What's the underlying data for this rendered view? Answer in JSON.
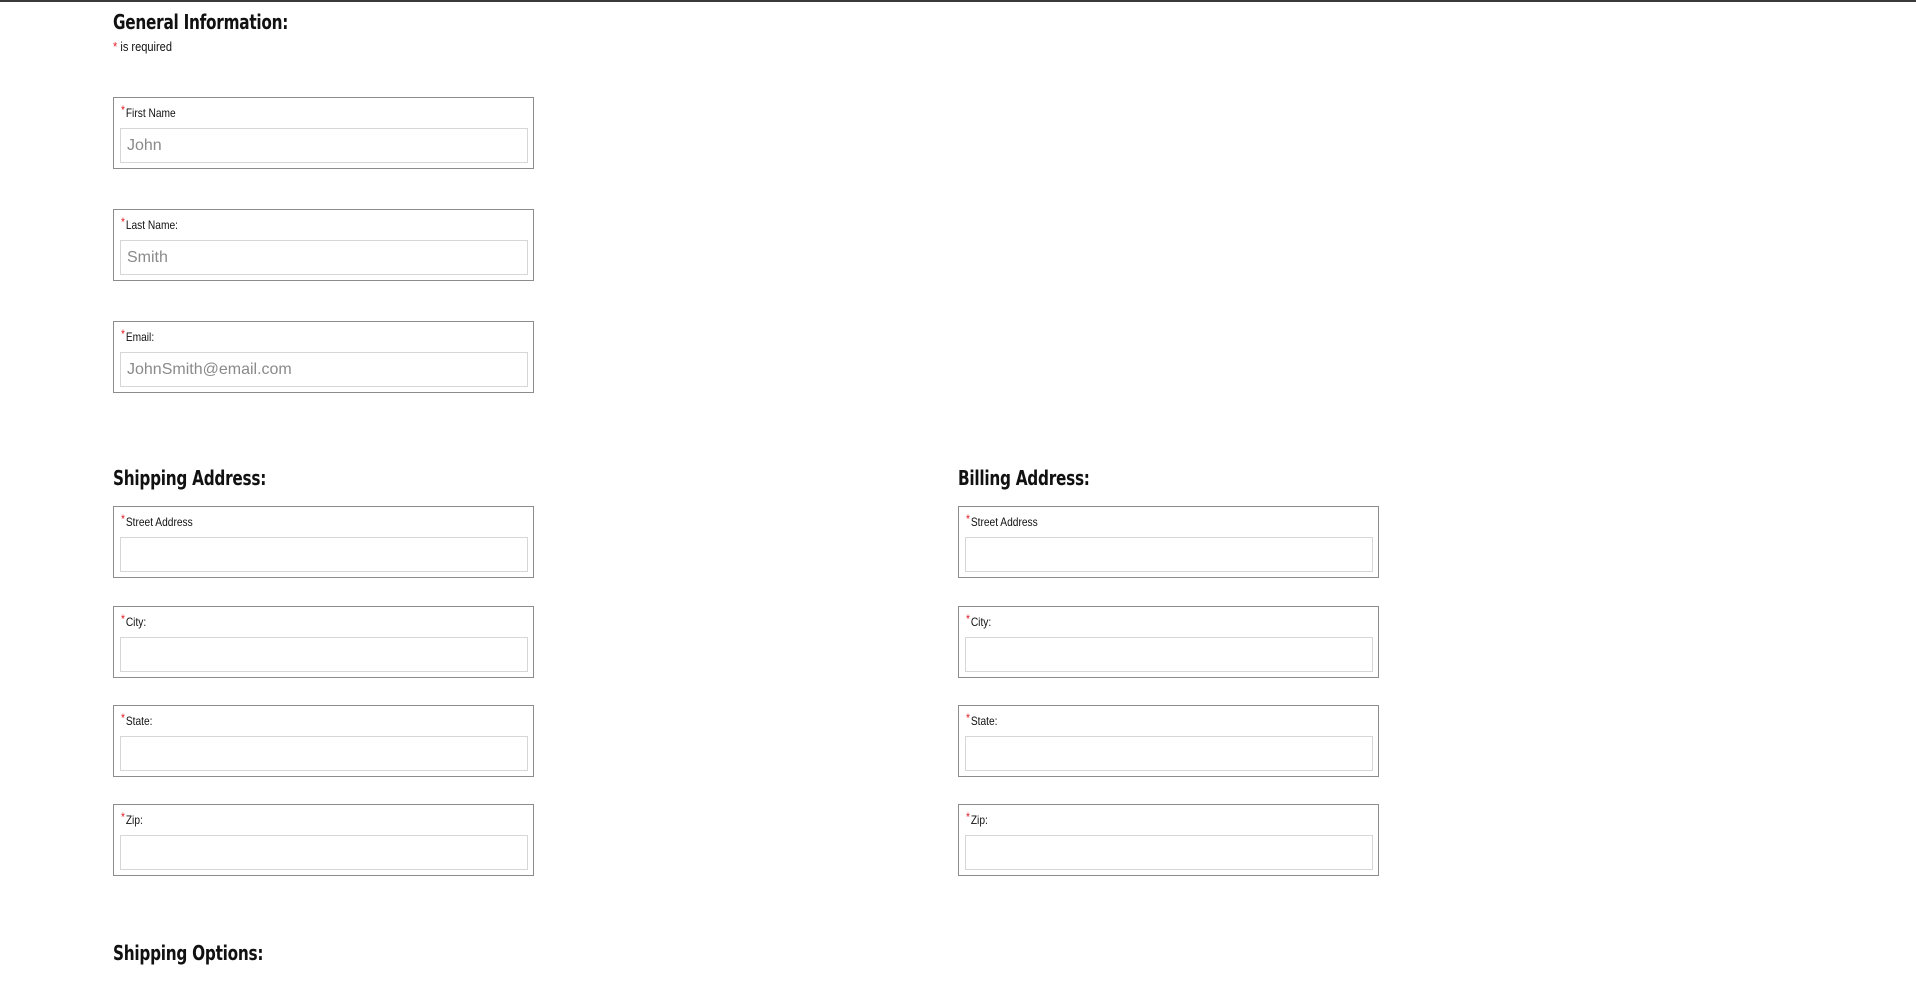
{
  "general": {
    "heading": "General Information:",
    "required_star": "*",
    "required_note": " is required",
    "first_name": {
      "label": "First Name",
      "placeholder": "John",
      "value": ""
    },
    "last_name": {
      "label": "Last Name:",
      "placeholder": "Smith",
      "value": ""
    },
    "email": {
      "label": "Email:",
      "placeholder": "JohnSmith@email.com",
      "value": ""
    }
  },
  "shipping": {
    "heading": "Shipping Address:",
    "street": {
      "label": "Street Address",
      "placeholder": "",
      "value": ""
    },
    "city": {
      "label": "City:",
      "placeholder": "",
      "value": ""
    },
    "state": {
      "label": "State:",
      "placeholder": "",
      "value": ""
    },
    "zip": {
      "label": "Zip:",
      "placeholder": "",
      "value": ""
    }
  },
  "billing": {
    "heading": "Billing Address:",
    "street": {
      "label": "Street Address",
      "placeholder": "",
      "value": ""
    },
    "city": {
      "label": "City:",
      "placeholder": "",
      "value": ""
    },
    "state": {
      "label": "State:",
      "placeholder": "",
      "value": ""
    },
    "zip": {
      "label": "Zip:",
      "placeholder": "",
      "value": ""
    }
  },
  "shipping_options": {
    "heading": "Shipping Options:"
  }
}
